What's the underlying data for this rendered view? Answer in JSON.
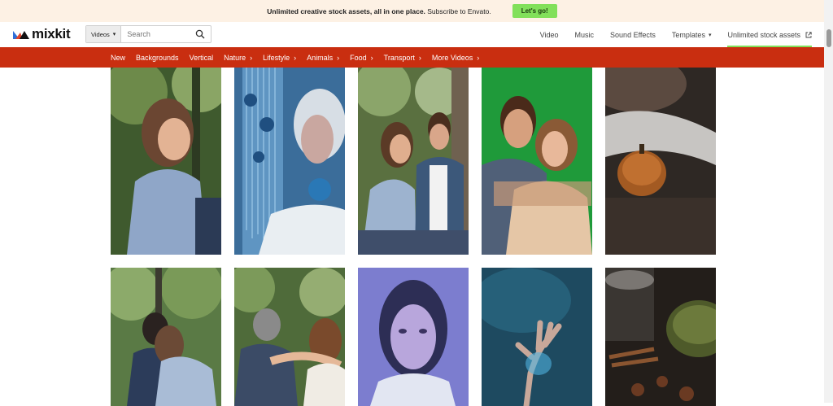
{
  "promo": {
    "text_bold": "Unlimited creative stock assets, all in one place.",
    "text_rest": " Subscribe to Envato.",
    "button": "Let's go!"
  },
  "logo": {
    "text": "mixkit"
  },
  "search": {
    "category": "Videos",
    "placeholder": "Search"
  },
  "nav": {
    "video": "Video",
    "music": "Music",
    "sound_effects": "Sound Effects",
    "templates": "Templates",
    "unlimited": "Unlimited stock assets"
  },
  "categories": [
    "New",
    "Backgrounds",
    "Vertical",
    "Nature",
    "Lifestyle",
    "Animals",
    "Food",
    "Transport",
    "More Videos"
  ],
  "colors": {
    "brand_red": "#c92e10",
    "accent_green": "#82e05a",
    "promo_bg": "#fdf1e4"
  }
}
